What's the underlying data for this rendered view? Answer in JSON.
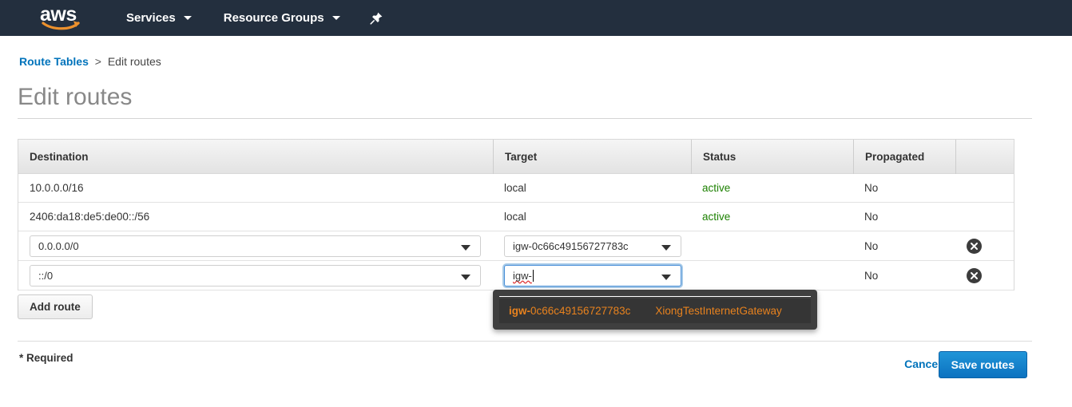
{
  "nav": {
    "logo_alt": "aws",
    "services_label": "Services",
    "resource_groups_label": "Resource Groups",
    "pin_icon": "pin-icon",
    "bar_color": "#232f3e",
    "accent_color": "#ec912d"
  },
  "breadcrumb": {
    "parent": "Route Tables",
    "separator": ">",
    "current": "Edit routes"
  },
  "page": {
    "title": "Edit routes"
  },
  "table": {
    "columns": [
      "Destination",
      "Target",
      "Status",
      "Propagated",
      ""
    ],
    "static_rows": [
      {
        "destination": "10.0.0.0/16",
        "target": "local",
        "status": "active",
        "propagated": "No"
      },
      {
        "destination": "2406:da18:de5:de00::/56",
        "target": "local",
        "status": "active",
        "propagated": "No"
      }
    ],
    "edit_rows": [
      {
        "destination": "0.0.0.0/0",
        "target": "igw-0c66c49156727783c",
        "status": "",
        "propagated": "No",
        "focused": false
      },
      {
        "destination": "::/0",
        "target": "igw-",
        "status": "",
        "propagated": "No",
        "focused": true
      }
    ],
    "status_color": "#1d8102",
    "remove_icon": "close-circle-icon"
  },
  "suggestions": {
    "match_prefix": "igw-",
    "match_rest": "0c66c49156727783c",
    "name": "XiongTestInternetGateway",
    "bg_color": "#3f3f3f",
    "text_color": "#e8821e"
  },
  "buttons": {
    "add_route": "Add route",
    "cancel": "Cancel",
    "save_routes": "Save routes"
  },
  "footer": {
    "required_note": "* Required"
  }
}
